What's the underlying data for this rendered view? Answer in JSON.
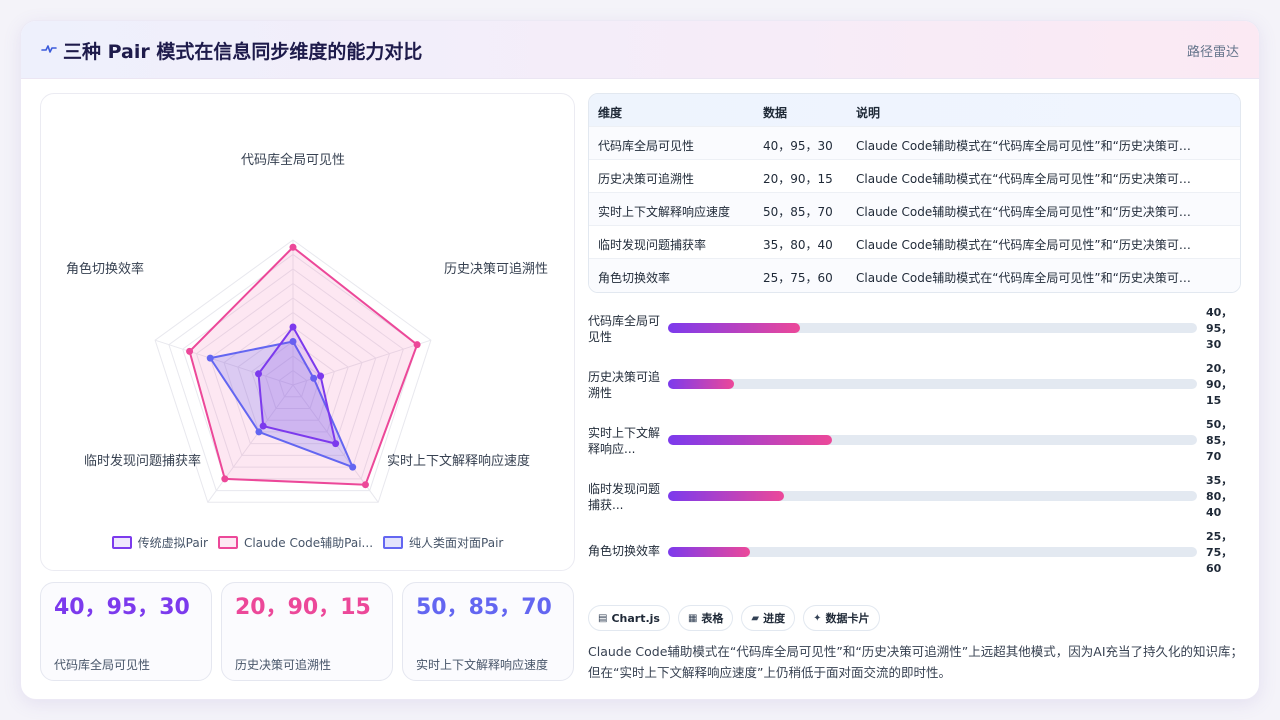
{
  "header": {
    "title": "三种 Pair 模式在信息同步维度的能力对比",
    "link": "路径雷达"
  },
  "colors": {
    "traditional": "#7c3aed",
    "claude": "#ec4899",
    "human": "#6366f1",
    "kpi1": "#7c3aed",
    "kpi2": "#ec4899",
    "kpi3": "#6366f1"
  },
  "chart_data": {
    "type": "radar",
    "axes": [
      "代码库全局可见性",
      "历史决策可追溯性",
      "实时上下文解释响应速度",
      "临时发现问题捕获率",
      "角色切换效率"
    ],
    "range": [
      0,
      100
    ],
    "grid": true,
    "legend_position": "bottom",
    "series": [
      {
        "name": "传统虚拟Pair",
        "values": [
          40,
          20,
          50,
          35,
          25
        ]
      },
      {
        "name": "Claude Code辅助Pai...",
        "values": [
          95,
          90,
          85,
          80,
          75
        ]
      },
      {
        "name": "纯人类面对面Pair",
        "values": [
          30,
          15,
          70,
          40,
          60
        ]
      }
    ]
  },
  "kpis": [
    {
      "value": "40，95，30",
      "label": "代码库全局可见性"
    },
    {
      "value": "20，90，15",
      "label": "历史决策可追溯性"
    },
    {
      "value": "50，85，70",
      "label": "实时上下文解释响应速度"
    }
  ],
  "table": {
    "headers": [
      "维度",
      "数据",
      "说明"
    ],
    "rows": [
      [
        "代码库全局可见性",
        "40，95，30",
        "Claude Code辅助模式在“代码库全局可见性”和“历史决策可追..."
      ],
      [
        "历史决策可追溯性",
        "20，90，15",
        "Claude Code辅助模式在“代码库全局可见性”和“历史决策可追..."
      ],
      [
        "实时上下文解释响应速度",
        "50，85，70",
        "Claude Code辅助模式在“代码库全局可见性”和“历史决策可追..."
      ],
      [
        "临时发现问题捕获率",
        "35，80，40",
        "Claude Code辅助模式在“代码库全局可见性”和“历史决策可追..."
      ],
      [
        "角色切换效率",
        "25，75，60",
        "Claude Code辅助模式在“代码库全局可见性”和“历史决策可追..."
      ]
    ]
  },
  "bars": [
    {
      "label": "代码库全局可见性",
      "value": "40，95，30",
      "progress": 25
    },
    {
      "label": "历史决策可追溯性",
      "value": "20，90，15",
      "progress": 12.5
    },
    {
      "label": "实时上下文解释响应...",
      "value": "50，85，70",
      "progress": 31
    },
    {
      "label": "临时发现问题捕获...",
      "value": "35，80，40",
      "progress": 22
    },
    {
      "label": "角色切换效率",
      "value": "25，75，60",
      "progress": 15.5
    }
  ],
  "chips": [
    {
      "icon": "▤",
      "label": "Chart.js"
    },
    {
      "icon": "▦",
      "label": "表格"
    },
    {
      "icon": "▰",
      "label": "进度"
    },
    {
      "icon": "✦",
      "label": "数据卡片"
    }
  ],
  "summary": "Claude Code辅助模式在“代码库全局可见性”和“历史决策可追溯性”上远超其他模式，因为AI充当了持久化的知识库；但在“实时上下文解释响应速度”上仍稍低于面对面交流的即时性。"
}
